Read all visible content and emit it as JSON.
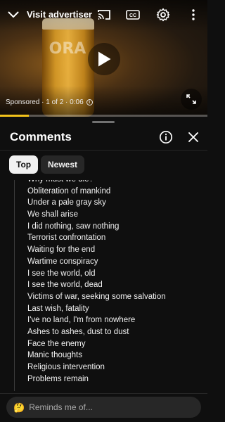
{
  "player": {
    "visit_advertiser": "Visit advertiser",
    "sponsored_text": "Sponsored · 1 of 2 · 0:06",
    "ad_progress_fraction": 0.14,
    "progress_color": "#f2c21b"
  },
  "icons": {
    "collapse": "chevron-down-icon",
    "cast": "cast-icon",
    "captions": "closed-captions-icon",
    "settings": "gear-icon",
    "more": "more-vertical-icon",
    "play": "play-icon",
    "fullscreen": "fullscreen-icon",
    "info": "info-icon",
    "close": "close-icon"
  },
  "comments": {
    "title": "Comments",
    "sort_chips": [
      "Top",
      "Newest"
    ],
    "selected_chip": "Top",
    "lines": [
      "Why must we die?",
      "Obliteration of mankind",
      "Under a pale gray sky",
      "We shall arise",
      "I did nothing, saw nothing",
      "Terrorist confrontation",
      "Waiting for the end",
      "Wartime conspiracy",
      "I see the world, old",
      "I see the world, dead",
      "Victims of war, seeking some salvation",
      "Last wish, fatality",
      "I've no land, I'm from nowhere",
      "Ashes to ashes, dust to dust",
      "Face the enemy",
      "Manic thoughts",
      "Religious intervention",
      "Problems remain"
    ]
  },
  "composer": {
    "emoji": "🤔",
    "placeholder": "Reminds me of..."
  }
}
